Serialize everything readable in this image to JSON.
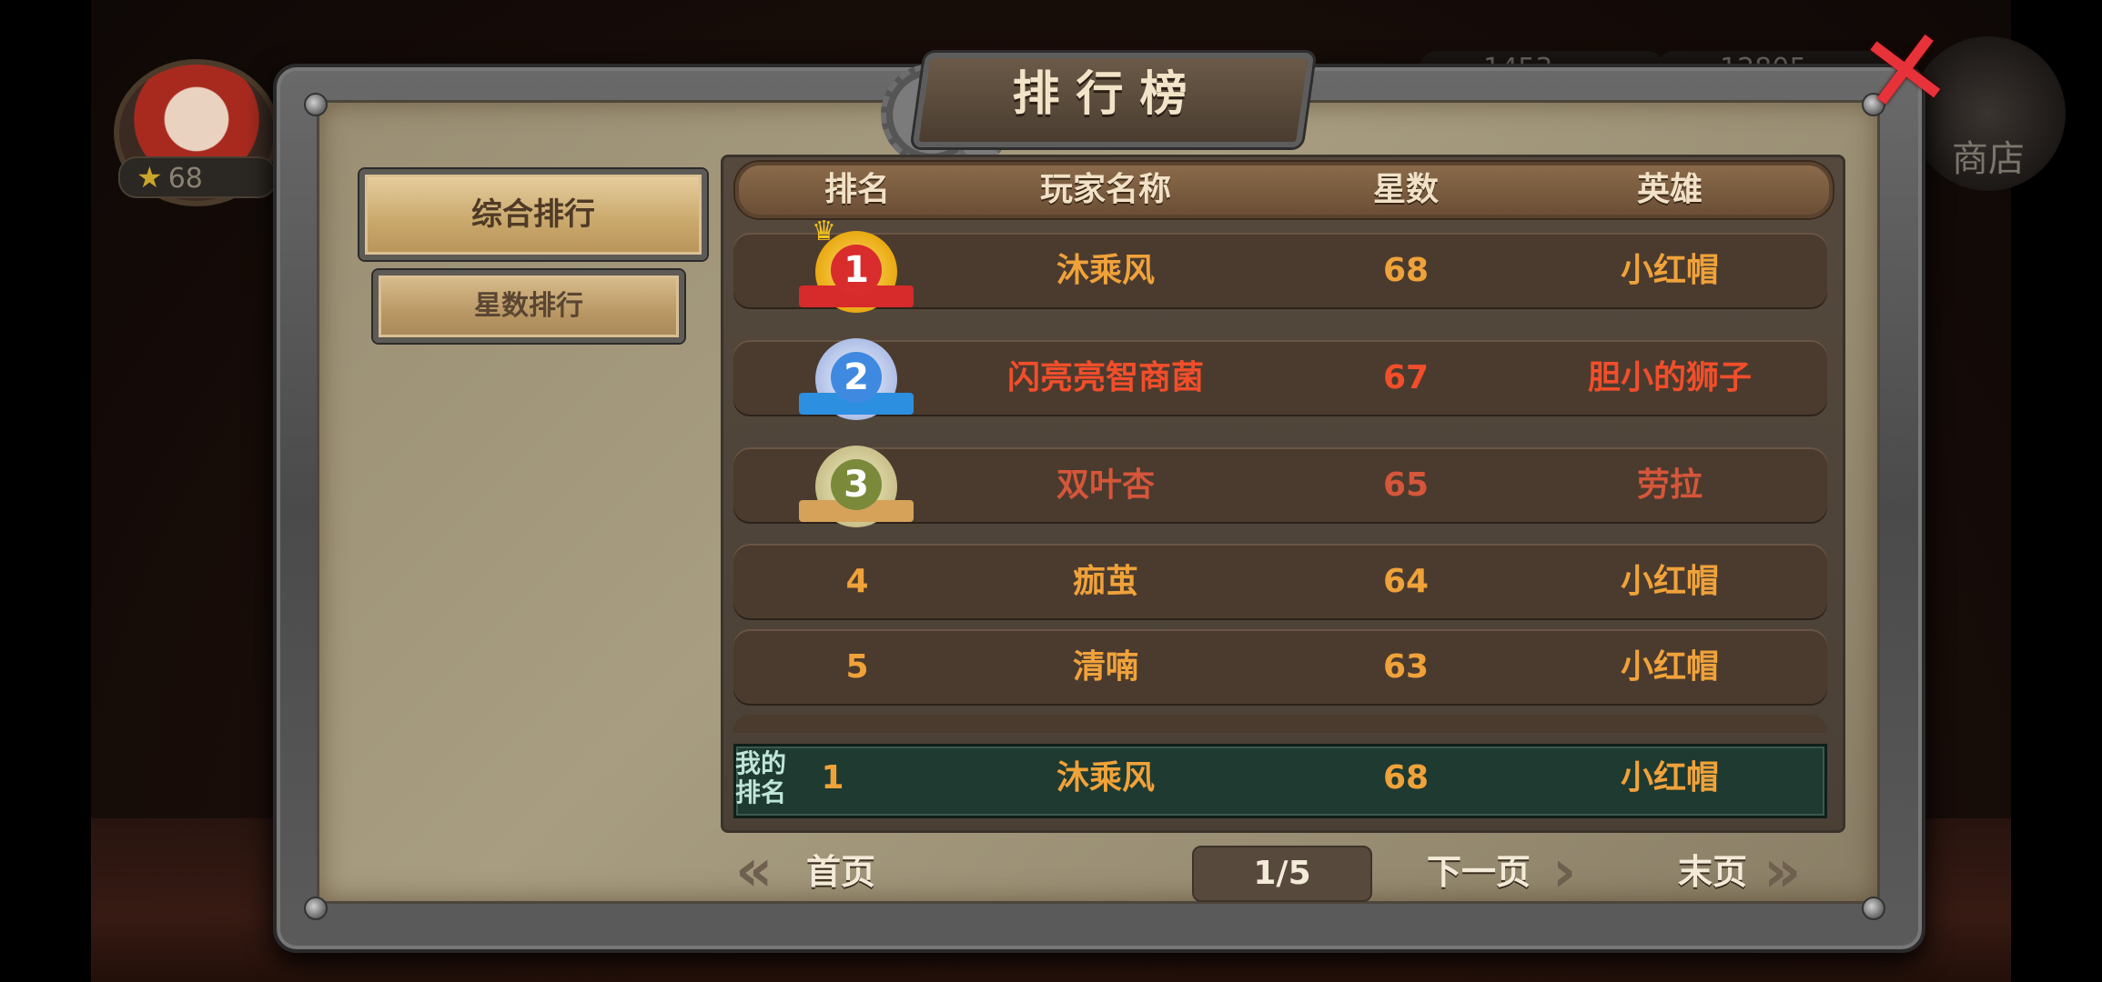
{
  "hud": {
    "stars": "68",
    "resource_1": "1453",
    "resource_2": "12805",
    "shop_label": "商店"
  },
  "window": {
    "title": "排行榜"
  },
  "sidebar": {
    "tabs": [
      {
        "label": "综合排行",
        "active": true
      },
      {
        "label": "星数排行",
        "active": false
      }
    ]
  },
  "table": {
    "headers": [
      "排名",
      "玩家名称",
      "星数",
      "英雄"
    ],
    "rows": [
      {
        "rank": "1",
        "name": "沐乘风",
        "stars": "68",
        "hero": "小红帽"
      },
      {
        "rank": "2",
        "name": "闪亮亮智商菌",
        "stars": "67",
        "hero": "胆小的狮子"
      },
      {
        "rank": "3",
        "name": "双叶杏",
        "stars": "65",
        "hero": "劳拉"
      },
      {
        "rank": "4",
        "name": "痂茧",
        "stars": "64",
        "hero": "小红帽"
      },
      {
        "rank": "5",
        "name": "清喃",
        "stars": "63",
        "hero": "小红帽"
      }
    ],
    "my_rank": {
      "label_line1": "我的",
      "label_line2": "排名",
      "rank": "1",
      "name": "沐乘风",
      "stars": "68",
      "hero": "小红帽"
    }
  },
  "pagination": {
    "first": "首页",
    "indicator": "1/5",
    "next": "下一页",
    "last": "末页"
  },
  "colors": {
    "gold_text": "#f0a23a",
    "red_text": "#f24e2b",
    "my_row_bg": "#1f3a30"
  }
}
